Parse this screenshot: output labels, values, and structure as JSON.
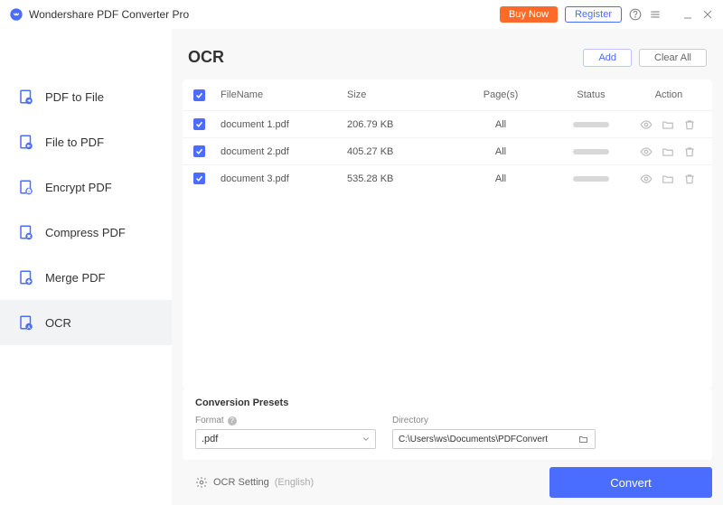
{
  "brand": "Wondershare PDF Converter Pro",
  "titlebar": {
    "buy": "Buy Now",
    "register": "Register"
  },
  "sidebar": {
    "items": [
      {
        "label": "PDF to File"
      },
      {
        "label": "File to PDF"
      },
      {
        "label": "Encrypt PDF"
      },
      {
        "label": "Compress PDF"
      },
      {
        "label": "Merge PDF"
      },
      {
        "label": "OCR"
      }
    ]
  },
  "page": {
    "title": "OCR",
    "add": "Add",
    "clear": "Clear All"
  },
  "table": {
    "headers": {
      "name": "FileName",
      "size": "Size",
      "pages": "Page(s)",
      "status": "Status",
      "action": "Action"
    },
    "rows": [
      {
        "name": "document 1.pdf",
        "size": "206.79 KB",
        "pages": "All"
      },
      {
        "name": "document 2.pdf",
        "size": "405.27 KB",
        "pages": "All"
      },
      {
        "name": "document 3.pdf",
        "size": "535.28 KB",
        "pages": "All"
      }
    ]
  },
  "presets": {
    "title": "Conversion Presets",
    "format_label": "Format",
    "format_value": ".pdf",
    "dir_label": "Directory",
    "dir_value": "C:\\Users\\ws\\Documents\\PDFConvert"
  },
  "footer": {
    "ocr_setting": "OCR Setting",
    "ocr_lang": "(English)",
    "convert": "Convert"
  }
}
